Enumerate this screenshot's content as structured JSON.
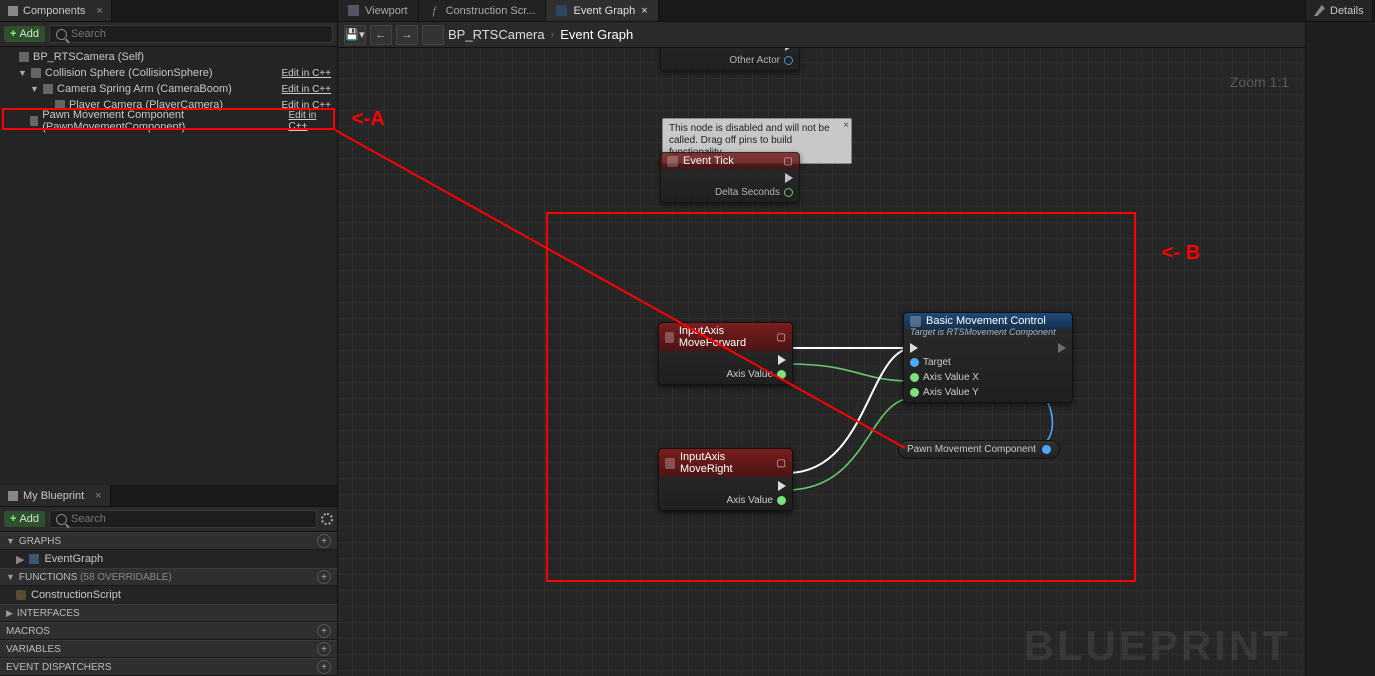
{
  "components_panel": {
    "title": "Components",
    "add_label": "Add",
    "search_placeholder": "Search",
    "tree": [
      {
        "label": "BP_RTSCamera (Self)",
        "edit": "",
        "indent": 0,
        "disclosure": ""
      },
      {
        "label": "Collision Sphere (CollisionSphere)",
        "edit": "Edit in C++",
        "indent": 1,
        "disclosure": "▼"
      },
      {
        "label": "Camera Spring Arm (CameraBoom)",
        "edit": "Edit in C++",
        "indent": 2,
        "disclosure": "▼"
      },
      {
        "label": "Player Camera (PlayerCamera)",
        "edit": "Edit in C++",
        "indent": 3,
        "disclosure": ""
      },
      {
        "label": "Pawn Movement Component (PawnMovementComponent)",
        "edit": "Edit in C++",
        "indent": 1,
        "disclosure": ""
      }
    ]
  },
  "my_blueprint": {
    "title": "My Blueprint",
    "add_label": "Add",
    "search_placeholder": "Search",
    "sections": {
      "graphs": {
        "label": "GRAPHS",
        "items": [
          "EventGraph"
        ]
      },
      "functions": {
        "label": "FUNCTIONS",
        "suffix": "(58 OVERRIDABLE)",
        "items": [
          "ConstructionScript"
        ]
      },
      "interfaces": {
        "label": "INTERFACES"
      },
      "macros": {
        "label": "MACROS"
      },
      "variables": {
        "label": "VARIABLES"
      },
      "dispatchers": {
        "label": "EVENT DISPATCHERS"
      }
    }
  },
  "tabs": {
    "viewport": "Viewport",
    "construction": "Construction Scr...",
    "event_graph": "Event Graph"
  },
  "breadcrumb": {
    "root": "BP_RTSCamera",
    "current": "Event Graph"
  },
  "zoom": "Zoom 1:1",
  "graph": {
    "watermark": "BLUEPRINT",
    "tooltip": "This node is disabled and will not be called. Drag off pins to build functionality.",
    "partial_node": {
      "pin": "Other Actor"
    },
    "event_tick": {
      "title": "Event Tick",
      "out": "Delta Seconds"
    },
    "move_forward": {
      "title": "InputAxis MoveForward",
      "out": "Axis Value"
    },
    "move_right": {
      "title": "InputAxis MoveRight",
      "out": "Axis Value"
    },
    "basic_movement": {
      "title": "Basic Movement Control",
      "subtitle": "Target is RTSMovement Component",
      "pins": {
        "target": "Target",
        "x": "Axis Value X",
        "y": "Axis Value Y"
      }
    },
    "var_pawn": "Pawn Movement Component"
  },
  "annotations": {
    "a": "<-A",
    "b": "<- B"
  },
  "details_panel": {
    "title": "Details"
  }
}
